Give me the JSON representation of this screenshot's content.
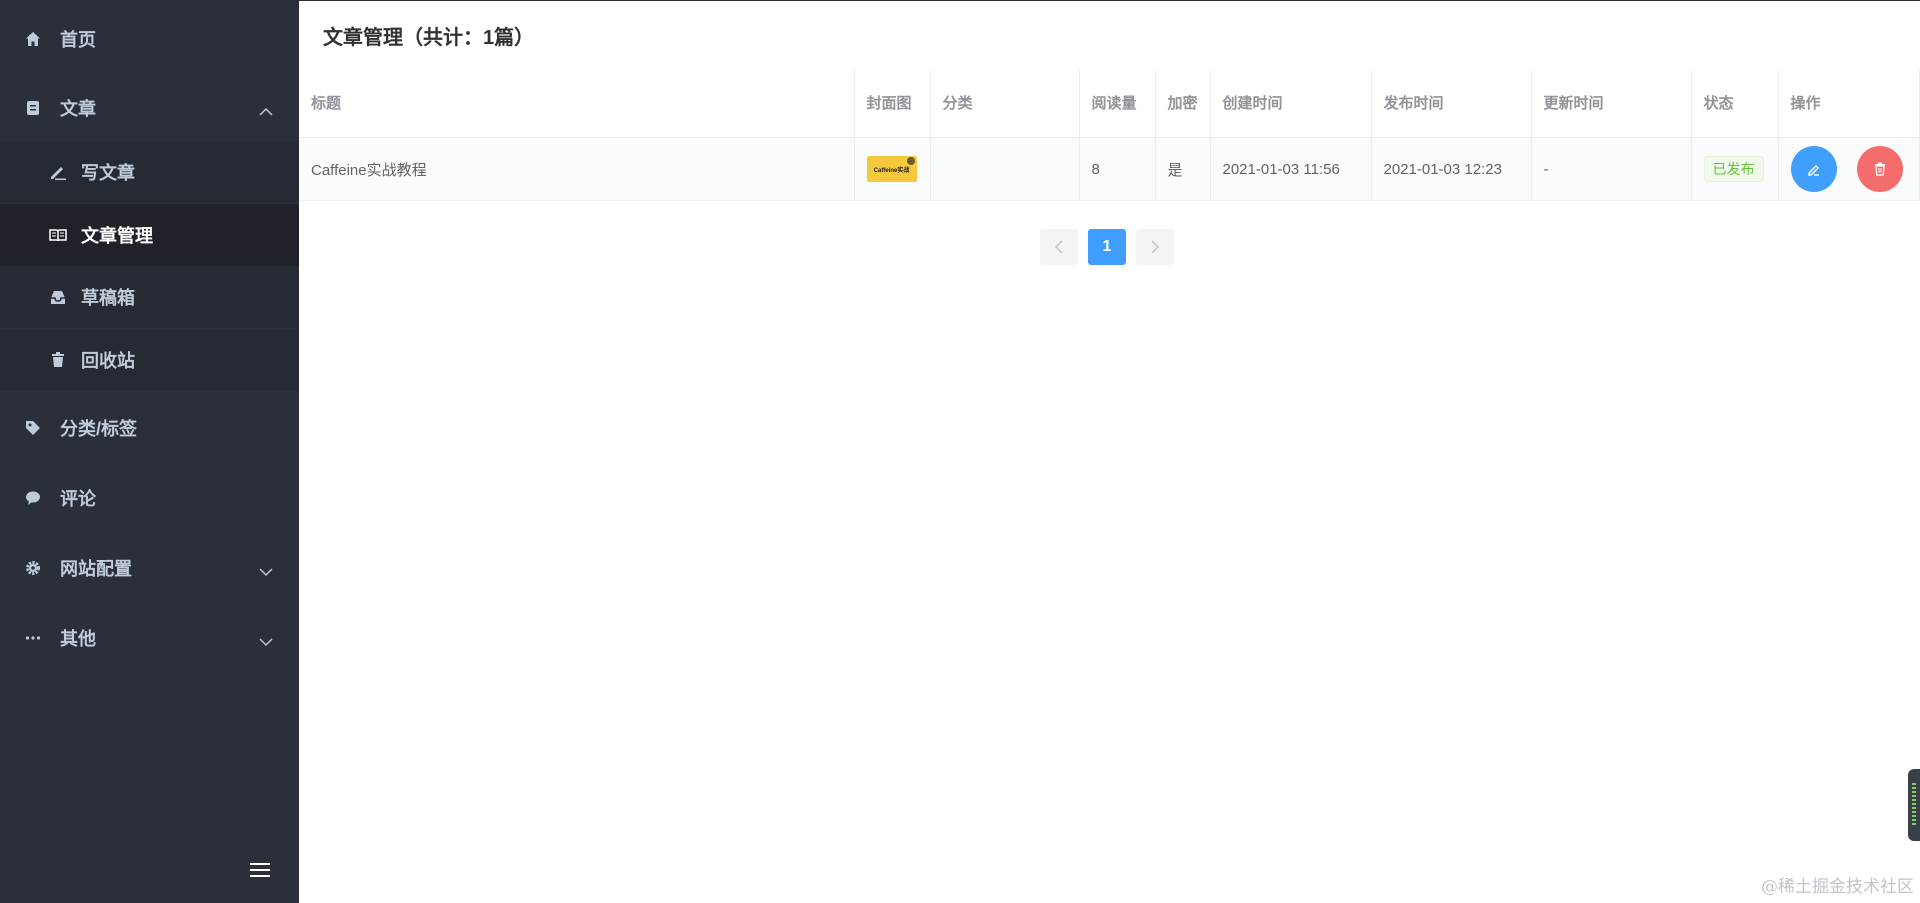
{
  "sidebar": {
    "home": "首页",
    "article": "文章",
    "write": "写文章",
    "manage": "文章管理",
    "drafts": "草稿箱",
    "recycle": "回收站",
    "category_tags": "分类/标签",
    "comments": "评论",
    "site_config": "网站配置",
    "other": "其他"
  },
  "header": {
    "title": "文章管理（共计：1篇）"
  },
  "table": {
    "columns": {
      "title": "标题",
      "cover": "封面图",
      "category": "分类",
      "views": "阅读量",
      "encrypt": "加密",
      "created": "创建时间",
      "published": "发布时间",
      "updated": "更新时间",
      "status": "状态",
      "actions": "操作"
    },
    "rows": [
      {
        "title": "Caffeine实战教程",
        "cover_text": "Caffeine实战",
        "category": "",
        "views": "8",
        "encrypt": "是",
        "created": "2021-01-03 11:56",
        "published": "2021-01-03 12:23",
        "updated": "-",
        "status": "已发布"
      }
    ]
  },
  "pagination": {
    "current": "1"
  },
  "watermark": "@稀土掘金技术社区",
  "colors": {
    "sidebar_bg": "#2b2f3a",
    "primary": "#409eff",
    "danger": "#f56c6c",
    "success": "#67c23a"
  }
}
